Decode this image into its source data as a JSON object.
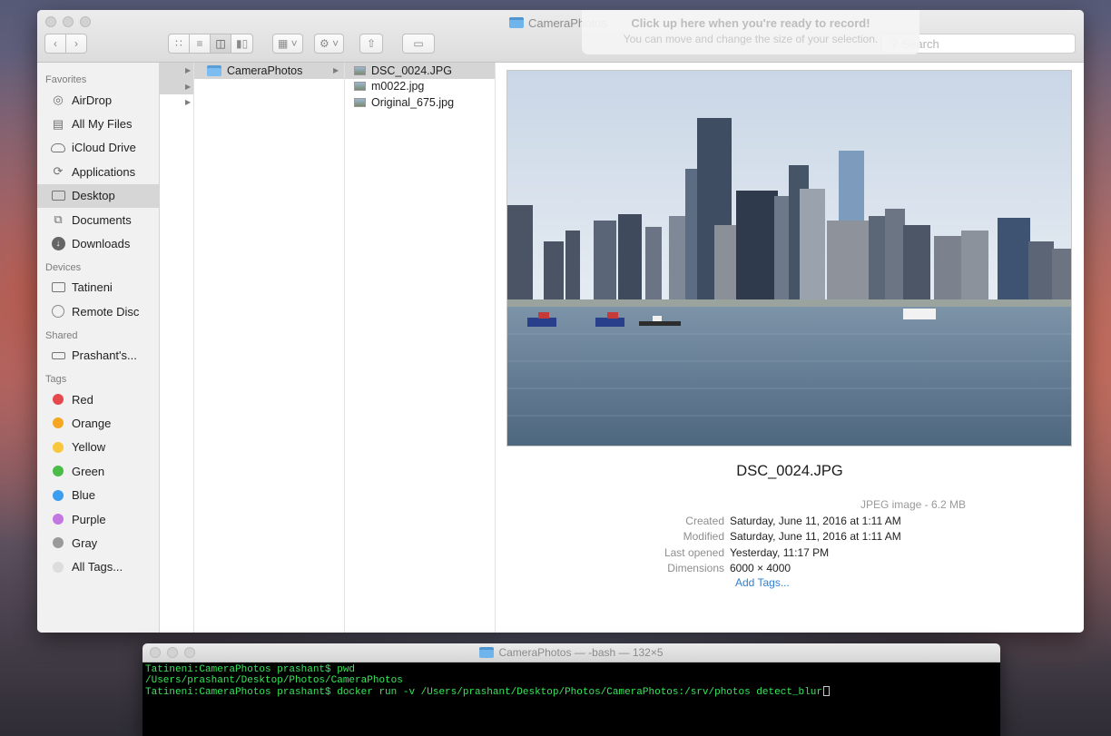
{
  "finder": {
    "window_title": "CameraPhotos",
    "search": {
      "placeholder": "Search",
      "value": ""
    },
    "record_hint": {
      "title": "Click up here when you're ready to record!",
      "subtitle": "You can move and change the size of your selection."
    },
    "sidebar": {
      "favorites_heading": "Favorites",
      "favorites": [
        {
          "label": "AirDrop",
          "icon": "airdrop-icon"
        },
        {
          "label": "All My Files",
          "icon": "all-files-icon"
        },
        {
          "label": "iCloud Drive",
          "icon": "cloud-icon"
        },
        {
          "label": "Applications",
          "icon": "applications-icon"
        },
        {
          "label": "Desktop",
          "icon": "desktop-icon",
          "selected": true
        },
        {
          "label": "Documents",
          "icon": "documents-icon"
        },
        {
          "label": "Downloads",
          "icon": "downloads-icon"
        }
      ],
      "devices_heading": "Devices",
      "devices": [
        {
          "label": "Tatineni",
          "icon": "laptop-icon"
        },
        {
          "label": "Remote Disc",
          "icon": "disc-icon"
        }
      ],
      "shared_heading": "Shared",
      "shared": [
        {
          "label": "Prashant's...",
          "icon": "network-drive-icon"
        }
      ],
      "tags_heading": "Tags",
      "tags": [
        {
          "label": "Red",
          "color": "#e5484d"
        },
        {
          "label": "Orange",
          "color": "#f5a623"
        },
        {
          "label": "Yellow",
          "color": "#f8c73b"
        },
        {
          "label": "Green",
          "color": "#4cbc48"
        },
        {
          "label": "Blue",
          "color": "#3b9cf0"
        },
        {
          "label": "Purple",
          "color": "#c377e0"
        },
        {
          "label": "Gray",
          "color": "#9a9a9a"
        },
        {
          "label": "All Tags...",
          "color": "#dcdcdc"
        }
      ]
    },
    "columns": {
      "folder": "CameraPhotos",
      "files": [
        {
          "name": "DSC_0024.JPG",
          "selected": true
        },
        {
          "name": "m0022.jpg"
        },
        {
          "name": "Original_675.jpg"
        }
      ]
    },
    "preview": {
      "file_name": "DSC_0024.JPG",
      "kind": "JPEG image - 6.2 MB",
      "meta": [
        {
          "label": "Created",
          "value": "Saturday, June 11, 2016 at 1:11 AM"
        },
        {
          "label": "Modified",
          "value": "Saturday, June 11, 2016 at 1:11 AM"
        },
        {
          "label": "Last opened",
          "value": "Yesterday, 11:17 PM"
        },
        {
          "label": "Dimensions",
          "value": "6000 × 4000"
        }
      ],
      "add_tags": "Add Tags..."
    }
  },
  "terminal": {
    "title": "CameraPhotos — -bash — 132×5",
    "lines": [
      "Tatineni:CameraPhotos prashant$ pwd",
      "/Users/prashant/Desktop/Photos/CameraPhotos",
      "Tatineni:CameraPhotos prashant$ docker run -v /Users/prashant/Desktop/Photos/CameraPhotos:/srv/photos detect_blur"
    ]
  }
}
